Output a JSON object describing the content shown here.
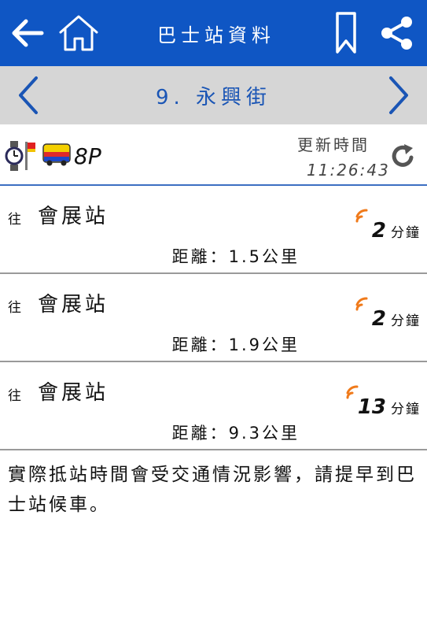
{
  "header": {
    "title": "巴士站資料",
    "brand_color": "#0f56c4"
  },
  "stop": {
    "name": "9. 永興街",
    "text_color": "#1a55b5"
  },
  "route": {
    "number": "8P",
    "update_label": "更新時間",
    "update_time": "11:26:43"
  },
  "arrivals": [
    {
      "to_label": "往",
      "destination": "會展站",
      "distance": "距離：1.5公里",
      "eta": "2",
      "eta_unit": "分鐘"
    },
    {
      "to_label": "往",
      "destination": "會展站",
      "distance": "距離：1.9公里",
      "eta": "2",
      "eta_unit": "分鐘"
    },
    {
      "to_label": "往",
      "destination": "會展站",
      "distance": "距離：9.3公里",
      "eta": "13",
      "eta_unit": "分鐘"
    }
  ],
  "notice": "實際抵站時間會受交通情況影響，請提早到巴士站候車。",
  "icons": {
    "back": "back-arrow-icon",
    "home": "home-icon",
    "bookmark": "bookmark-icon",
    "share": "share-icon",
    "prev": "chevron-left-icon",
    "next": "chevron-right-icon",
    "refresh": "refresh-icon",
    "signal": "signal-icon",
    "signal_color": "#f07a1a"
  }
}
